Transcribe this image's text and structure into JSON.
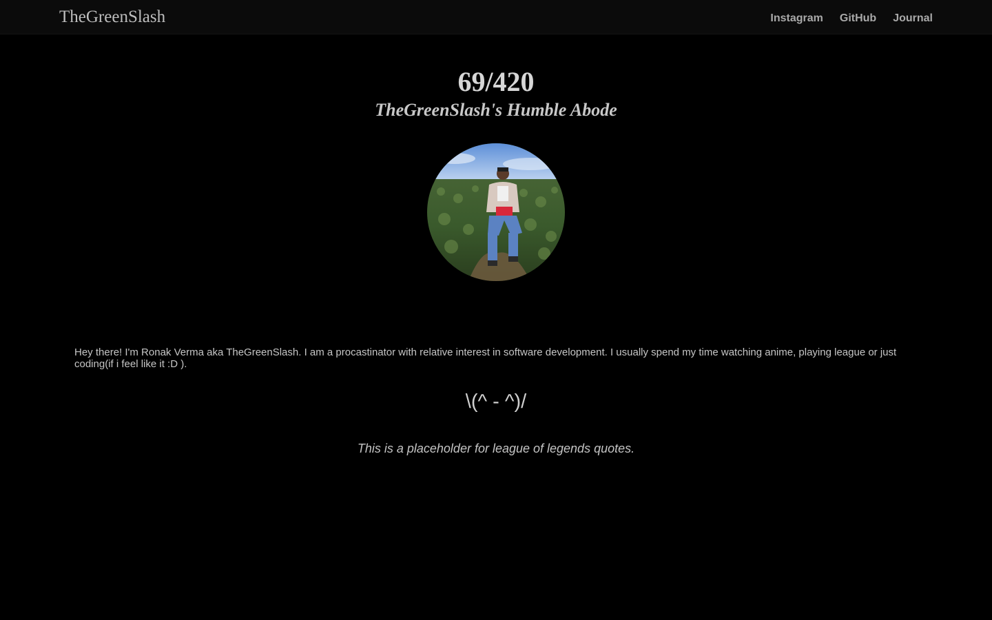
{
  "navbar": {
    "brand": "TheGreenSlash",
    "links": [
      {
        "label": "Instagram"
      },
      {
        "label": "GitHub"
      },
      {
        "label": "Journal"
      }
    ]
  },
  "hero": {
    "counter": "69/420",
    "subtitle": "TheGreenSlash's Humble Abode"
  },
  "avatar": {
    "alt": "Profile photo of Ronak Verma sitting in a tea field"
  },
  "content": {
    "bio": "Hey there! I'm Ronak Verma aka TheGreenSlash. I am a procastinator with relative interest in software development. I usually spend my time watching anime, playing league or just coding(if i feel like it :D ).",
    "kaomoji": "\\(^ - ^)/",
    "quote": "This is a placeholder for league of legends quotes."
  },
  "colors": {
    "background": "#000000",
    "navbar": "#0b0b0b",
    "text": "#cfcfcf"
  }
}
